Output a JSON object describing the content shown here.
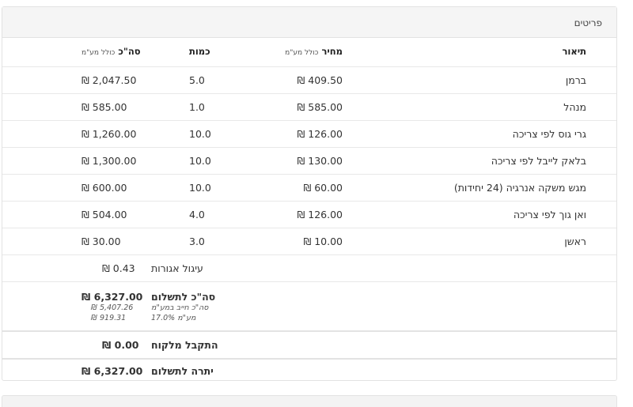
{
  "panel": {
    "title": "פריטים"
  },
  "columns": {
    "description": "תיאור",
    "price": "מחיר",
    "price_note": "כולל מע\"מ",
    "quantity": "כמות",
    "total": "סה\"כ",
    "total_note": "כולל מע\"מ"
  },
  "items": [
    {
      "description": "ברמן",
      "price": "₪ 409.50",
      "quantity": "5.0",
      "total": "₪ 2,047.50"
    },
    {
      "description": "מנהל",
      "price": "₪ 585.00",
      "quantity": "1.0",
      "total": "₪ 585.00"
    },
    {
      "description": "גרי גוס לפי צריכה",
      "price": "₪ 126.00",
      "quantity": "10.0",
      "total": "₪ 1,260.00"
    },
    {
      "description": "בלאק לייבל לפי צריכה",
      "price": "₪ 130.00",
      "quantity": "10.0",
      "total": "₪ 1,300.00"
    },
    {
      "description": "מגש משקה אנרגיה (24 יחידות)",
      "price": "₪ 60.00",
      "quantity": "10.0",
      "total": "₪ 600.00"
    },
    {
      "description": "ואן גוך לפי צריכה",
      "price": "₪ 126.00",
      "quantity": "4.0",
      "total": "₪ 504.00"
    },
    {
      "description": "ראשן",
      "price": "₪ 10.00",
      "quantity": "3.0",
      "total": "₪ 30.00"
    }
  ],
  "rounding": {
    "label": "עיגול אגורות",
    "value": "₪ 0.43"
  },
  "summary": {
    "total_label": "סה\"כ לתשלום",
    "total_value": "₪ 6,327.00",
    "vat_base_label": "סה\"כ חייב במע\"מ",
    "vat_base_value": "₪ 5,407.26",
    "vat_label": "מע\"מ 17.0%",
    "vat_value": "₪ 919.31"
  },
  "received": {
    "label": "התקבל מלקוח",
    "value": "₪ 0.00"
  },
  "balance": {
    "label": "יתרה לתשלום",
    "value": "₪ 6,327.00"
  }
}
